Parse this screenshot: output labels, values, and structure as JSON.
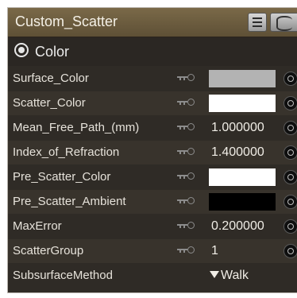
{
  "panel": {
    "title": "Custom_Scatter",
    "section_label": "Color"
  },
  "colors": {
    "header": "#6b5b40",
    "panel_bg": "#2f2b26",
    "row_alt_bg": "#38332c"
  },
  "properties": [
    {
      "name": "Surface_Color",
      "kind": "swatch",
      "color": "#b3b3b3"
    },
    {
      "name": "Scatter_Color",
      "kind": "swatch",
      "color": "#ffffff"
    },
    {
      "name": "Mean_Free_Path_(mm)",
      "kind": "number",
      "value": "1.000000"
    },
    {
      "name": "Index_of_Refraction",
      "kind": "number",
      "value": "1.400000"
    },
    {
      "name": "Pre_Scatter_Color",
      "kind": "swatch",
      "color": "#ffffff"
    },
    {
      "name": "Pre_Scatter_Ambient",
      "kind": "swatch",
      "color": "#000000"
    },
    {
      "name": "MaxError",
      "kind": "number",
      "value": "0.200000"
    },
    {
      "name": "ScatterGroup",
      "kind": "number",
      "value": "1"
    },
    {
      "name": "SubsurfaceMethod",
      "kind": "dropdown",
      "value": "Walk"
    }
  ],
  "icons": {
    "menu": "list-menu-icon",
    "preview": "cylinder-icon",
    "section": "radio-target-icon",
    "link": "link-chain-icon",
    "input_knob": "input-knob-icon",
    "dropdown_arrow": "triangle-down-icon"
  }
}
